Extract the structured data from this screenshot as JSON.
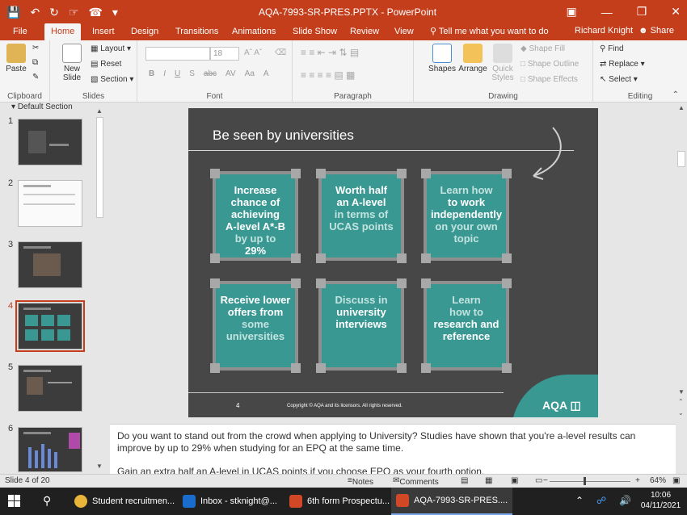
{
  "window": {
    "title": "AQA-7993-SR-PRES.PPTX - PowerPoint",
    "qat_icons": [
      "save-icon",
      "undo-icon",
      "redo-icon",
      "touch-mode-icon",
      "presenter-icon",
      "customize-icon"
    ]
  },
  "ribbon_tabs": [
    {
      "label": "File"
    },
    {
      "label": "Home"
    },
    {
      "label": "Insert"
    },
    {
      "label": "Design"
    },
    {
      "label": "Transitions"
    },
    {
      "label": "Animations"
    },
    {
      "label": "Slide Show"
    },
    {
      "label": "Review"
    },
    {
      "label": "View"
    }
  ],
  "tell_me": "Tell me what you want to do",
  "user_name": "Richard Knight",
  "share_label": "Share",
  "ribbon": {
    "clipboard": {
      "label": "Clipboard",
      "paste": "Paste"
    },
    "slides": {
      "label": "Slides",
      "new_slide": "New Slide",
      "layout": "Layout",
      "reset": "Reset",
      "section": "Section"
    },
    "font": {
      "label": "Font",
      "size": "18",
      "buttons": [
        "B",
        "I",
        "U",
        "S",
        "abc",
        "AV",
        "Aa",
        "A"
      ]
    },
    "paragraph": {
      "label": "Paragraph"
    },
    "drawing": {
      "label": "Drawing",
      "shapes": "Shapes",
      "arrange": "Arrange",
      "quick_styles": "Quick Styles",
      "shape_fill": "Shape Fill",
      "shape_outline": "Shape Outline",
      "shape_effects": "Shape Effects"
    },
    "editing": {
      "label": "Editing",
      "find": "Find",
      "replace": "Replace",
      "select": "Select"
    }
  },
  "thumbnails": {
    "section": "Default Section",
    "items": [
      {
        "num": "1"
      },
      {
        "num": "2"
      },
      {
        "num": "3"
      },
      {
        "num": "4"
      },
      {
        "num": "5"
      },
      {
        "num": "6"
      }
    ]
  },
  "slide": {
    "title": "Be seen by universities",
    "boxes": [
      {
        "lines": [
          {
            "text": "Increase",
            "light": false
          },
          {
            "text": "chance of",
            "light": false
          },
          {
            "text": "achieving",
            "light": false
          },
          {
            "text": "A-level A*-B",
            "light": false
          },
          {
            "text": "by up to",
            "light": true
          },
          {
            "text": "29%",
            "light": false
          }
        ]
      },
      {
        "lines": [
          {
            "text": "Worth half",
            "light": false
          },
          {
            "text": "an A-level",
            "light": false
          },
          {
            "text": "in terms of",
            "light": true
          },
          {
            "text": "UCAS points",
            "light": true
          }
        ]
      },
      {
        "lines": [
          {
            "text": "Learn how",
            "light": true
          },
          {
            "text": "to work",
            "light": false
          },
          {
            "text": "independently",
            "light": false
          },
          {
            "text": "on your own",
            "light": true
          },
          {
            "text": "topic",
            "light": true
          }
        ]
      },
      {
        "lines": [
          {
            "text": "Receive lower",
            "light": false
          },
          {
            "text": "offers from",
            "light": false
          },
          {
            "text": "some",
            "light": true
          },
          {
            "text": "universities",
            "light": true
          }
        ]
      },
      {
        "lines": [
          {
            "text": "Discuss in",
            "light": true
          },
          {
            "text": "university",
            "light": false
          },
          {
            "text": "interviews",
            "light": false
          }
        ]
      },
      {
        "lines": [
          {
            "text": "Learn",
            "light": true
          },
          {
            "text": "how to",
            "light": true
          },
          {
            "text": "research and",
            "light": false
          },
          {
            "text": "reference",
            "light": false
          }
        ]
      }
    ],
    "page_number": "4",
    "copyright": "Copyright © AQA and its licensors. All rights reserved.",
    "logo": "AQA"
  },
  "notes": {
    "para1": "Do you want to stand out from the crowd when applying to University? Studies have shown that you're a-level results can improve by up to 29% when studying for an EPQ at the same time.",
    "para2": "Gain an extra half an A-level in UCAS points if you choose EPQ as your fourth option."
  },
  "status": {
    "slide_of": "Slide 4 of 20",
    "notes": "Notes",
    "comments": "Comments",
    "zoom": "64%"
  },
  "taskbar": {
    "tasks": [
      {
        "label": "Student recruitmen...",
        "icon": "chrome-icon",
        "color": "#e8b43a"
      },
      {
        "label": "Inbox - stknight@...",
        "icon": "outlook-icon",
        "color": "#1a6dcc"
      },
      {
        "label": "6th form Prospectu...",
        "icon": "powerpoint-icon",
        "color": "#d24726"
      },
      {
        "label": "AQA-7993-SR-PRES....",
        "icon": "powerpoint-icon",
        "color": "#d24726"
      }
    ],
    "time": "10:06",
    "date": "04/11/2021"
  },
  "colors": {
    "accent": "#c43e1c",
    "teal": "#3a9893",
    "slide_bg": "#474747"
  }
}
